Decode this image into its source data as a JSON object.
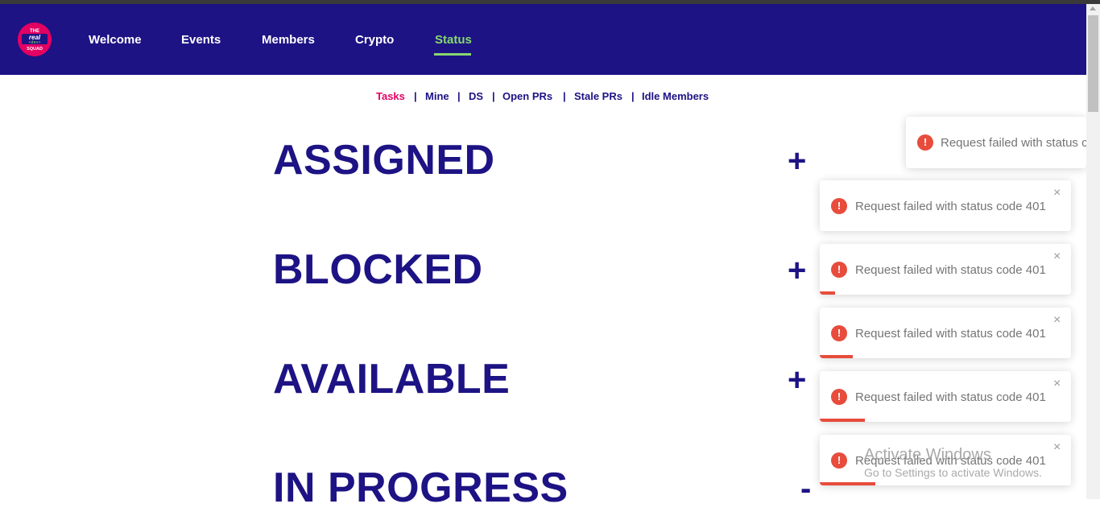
{
  "nav": {
    "links": [
      "Welcome",
      "Events",
      "Members",
      "Crypto",
      "Status"
    ],
    "active": "Status"
  },
  "subnav": {
    "links": [
      "Tasks",
      "Mine",
      "DS",
      "Open PRs",
      "Stale PRs",
      "Idle Members"
    ],
    "separator": "|",
    "active": "Tasks"
  },
  "sections": [
    {
      "title": "ASSIGNED",
      "toggle": "+"
    },
    {
      "title": "BLOCKED",
      "toggle": "+"
    },
    {
      "title": "AVAILABLE",
      "toggle": "+"
    },
    {
      "title": "IN  PROGRESS",
      "toggle": "-"
    }
  ],
  "toasts": [
    {
      "message": "Request failed with status c",
      "icon": "error-icon",
      "closable": false,
      "progress": 0
    },
    {
      "message": "Request failed with status code 401",
      "icon": "error-icon",
      "closable": true,
      "close_icon": "×",
      "progress": 0
    },
    {
      "message": "Request failed with status code 401",
      "icon": "error-icon",
      "closable": true,
      "close_icon": "×",
      "progress": 0.06
    },
    {
      "message": "Request failed with status code 401",
      "icon": "error-icon",
      "closable": true,
      "close_icon": "×",
      "progress": 0.13
    },
    {
      "message": "Request failed with status code 401",
      "icon": "error-icon",
      "closable": true,
      "close_icon": "×",
      "progress": 0.18
    },
    {
      "message": "Request failed with status code 401",
      "icon": "error-icon",
      "closable": true,
      "close_icon": "×",
      "progress": 0.22
    }
  ],
  "toast_icon_glyph": "!",
  "watermark": {
    "title": "Activate Windows",
    "subtitle": "Go to Settings to activate Windows."
  },
  "colors": {
    "navbar": "#1d1384",
    "nav_active": "#87d870",
    "subnav_active": "#e30062",
    "section_title": "#1d1384",
    "error": "#e74c3c"
  }
}
